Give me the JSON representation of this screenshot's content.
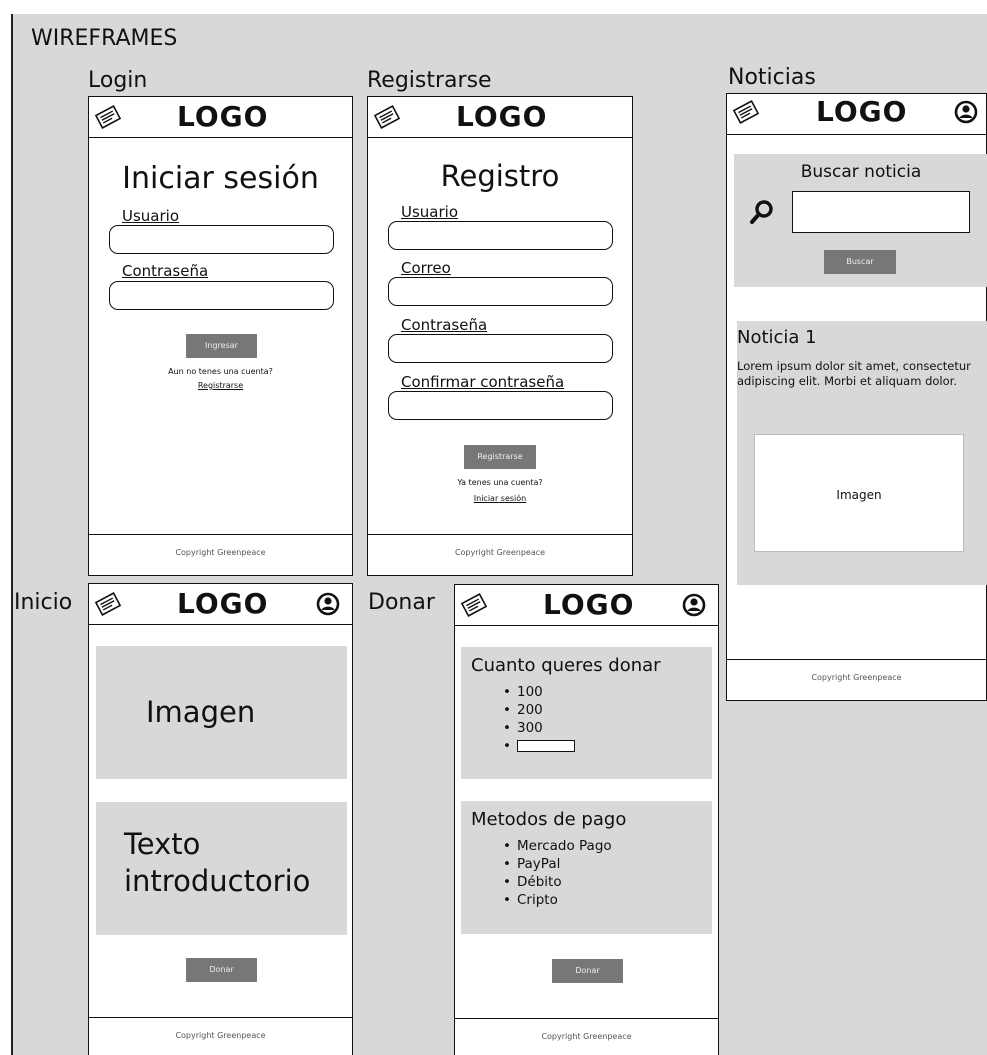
{
  "page_title": "WIREFRAMES",
  "logo_text": "LOGO",
  "copyright": "Copyright Greenpeace",
  "login": {
    "frame_label": "Login",
    "heading": "Iniciar sesión",
    "user_label": "Usuario",
    "password_label": "Contraseña",
    "submit_label": "Ingresar",
    "no_account_text": "Aun no tenes una cuenta?",
    "register_link": "Registrarse"
  },
  "register": {
    "frame_label": "Registrarse",
    "heading": "Registro",
    "user_label": "Usuario",
    "email_label": "Correo",
    "password_label": "Contraseña",
    "confirm_label": "Confirmar contraseña",
    "submit_label": "Registrarse",
    "has_account_text": "Ya tenes una cuenta?",
    "login_link": "Iniciar sesión"
  },
  "news": {
    "frame_label": "Noticias",
    "search_title": "Buscar noticia",
    "search_button": "Buscar",
    "item_title": "Noticia 1",
    "item_text": "Lorem ipsum dolor sit amet, consectetur adipiscing elit. Morbi et aliquam dolor.",
    "image_label": "Imagen"
  },
  "home": {
    "frame_label": "Inicio",
    "image_label": "Imagen",
    "intro_text": "Texto introductorio",
    "donate_button": "Donar"
  },
  "donate": {
    "frame_label": "Donar",
    "amount_title": "Cuanto queres donar",
    "amounts": [
      "100",
      "200",
      "300"
    ],
    "payment_title": "Metodos de pago",
    "payment_methods": [
      "Mercado Pago",
      "PayPal",
      "Débito",
      "Cripto"
    ],
    "donate_button": "Donar"
  },
  "icons": {
    "menu": "newspaper-icon",
    "user": "user-icon",
    "search": "search-icon"
  }
}
